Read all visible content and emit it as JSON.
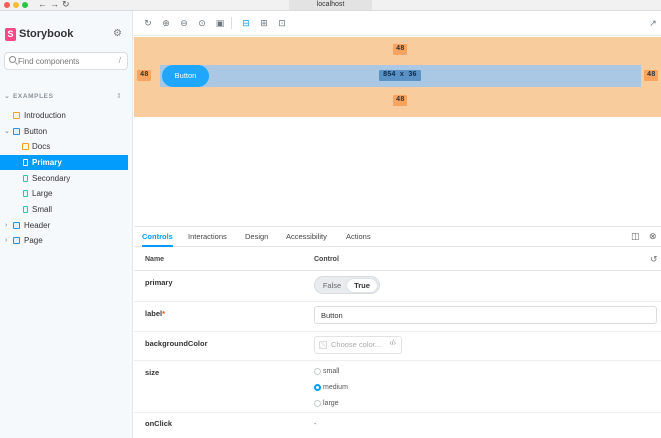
{
  "browser": {
    "url": "localhost"
  },
  "sidebar": {
    "brand": "Storybook",
    "search_placeholder": "Find components",
    "search_shortcut": "/",
    "section_title": "EXAMPLES",
    "items": [
      {
        "label": "Introduction",
        "type": "doc"
      },
      {
        "label": "Button",
        "type": "component"
      },
      {
        "label": "Docs",
        "type": "doc"
      },
      {
        "label": "Primary",
        "type": "story",
        "selected": true
      },
      {
        "label": "Secondary",
        "type": "story"
      },
      {
        "label": "Large",
        "type": "story"
      },
      {
        "label": "Small",
        "type": "story"
      },
      {
        "label": "Header",
        "type": "component"
      },
      {
        "label": "Page",
        "type": "component"
      }
    ]
  },
  "canvas": {
    "button_label": "Button",
    "margin_top": "48",
    "margin_bottom": "48",
    "margin_left": "48",
    "margin_right": "48",
    "dimensions": "854 x 36"
  },
  "panel": {
    "tabs": [
      "Controls",
      "Interactions",
      "Design",
      "Accessibility",
      "Actions"
    ],
    "active_tab": "Controls",
    "header_name": "Name",
    "header_control": "Control",
    "rows": {
      "primary": {
        "name": "primary",
        "false_label": "False",
        "true_label": "True",
        "value": true
      },
      "label": {
        "name": "label",
        "required_mark": "*",
        "value": "Button"
      },
      "backgroundColor": {
        "name": "backgroundColor",
        "placeholder": "Choose color...",
        "code": "‹/›"
      },
      "size": {
        "name": "size",
        "options": [
          "small",
          "medium",
          "large"
        ],
        "selected": "medium"
      },
      "onClick": {
        "name": "onClick",
        "value": "-"
      }
    }
  },
  "colors": {
    "accent": "#029cfd",
    "brand": "#ff4785",
    "margin_overlay": "#f9cc9d",
    "content_overlay": "#aac8e4",
    "story_button": "#1ea7fd"
  }
}
